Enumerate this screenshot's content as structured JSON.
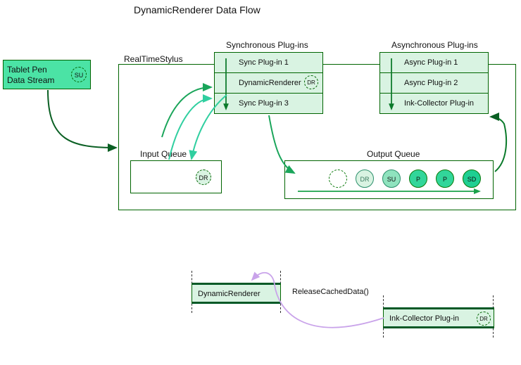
{
  "title": "DynamicRenderer Data Flow",
  "tablet": {
    "line1": "Tablet Pen",
    "line2": "Data Stream",
    "badge": "SU"
  },
  "rts": {
    "label": "RealTimeStylus"
  },
  "sync": {
    "label": "Synchronous Plug-ins",
    "items": [
      "Sync Plug-in 1",
      "DynamicRenderer",
      "Sync Plug-in 3"
    ],
    "dr_badge": "DR"
  },
  "async": {
    "label": "Asynchronous Plug-ins",
    "items": [
      "Async Plug-in 1",
      "Async Plug-in 2",
      "Ink-Collector Plug-in"
    ]
  },
  "input_queue": {
    "label": "Input Queue",
    "badge": "DR"
  },
  "output_queue": {
    "label": "Output Queue",
    "items": [
      {
        "text": "",
        "class": "dashed"
      },
      {
        "text": "DR",
        "class": "faded"
      },
      {
        "text": "SU",
        "class": "su"
      },
      {
        "text": "P",
        "class": "p"
      },
      {
        "text": "P",
        "class": "p"
      },
      {
        "text": "SD",
        "class": "sd"
      }
    ]
  },
  "bottom": {
    "dynamic_renderer": "DynamicRenderer",
    "release": "ReleaseCachedData()",
    "ink_collector": "Ink-Collector Plug-in",
    "dr_badge": "DR"
  }
}
